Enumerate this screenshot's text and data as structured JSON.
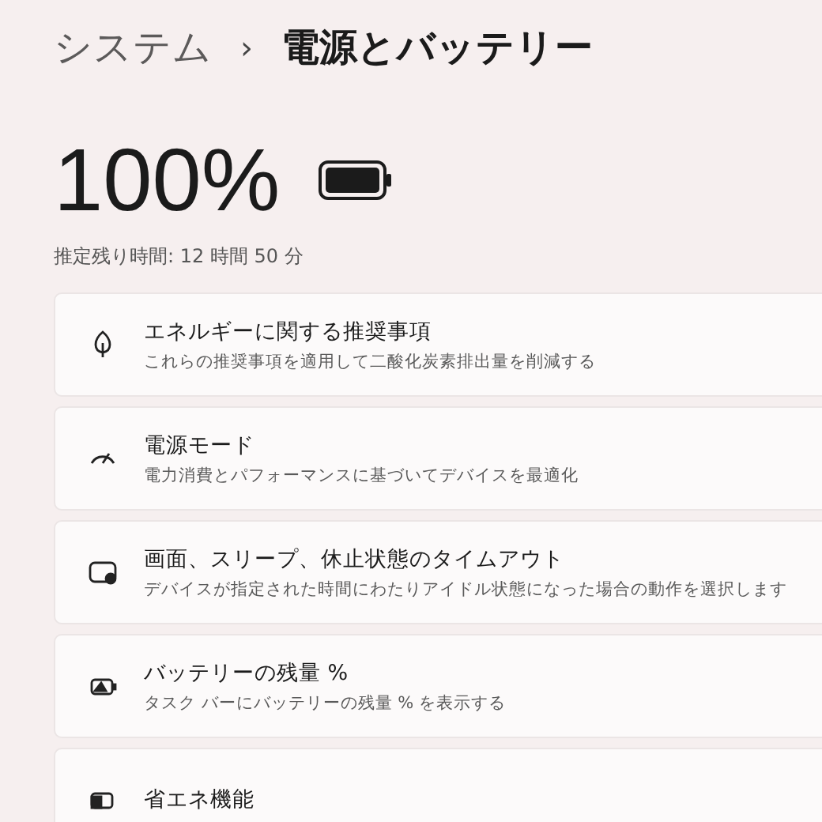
{
  "breadcrumb": {
    "parent": "システム",
    "separator": "›",
    "current": "電源とバッテリー"
  },
  "battery": {
    "percent": "100%",
    "estimate": "推定残り時間: 12 時間 50 分"
  },
  "settings": [
    {
      "kind": "leaf",
      "title": "エネルギーに関する推奨事項",
      "description": "これらの推奨事項を適用して二酸化炭素排出量を削減する"
    },
    {
      "kind": "gauge",
      "title": "電源モード",
      "description": "電力消費とパフォーマンスに基づいてデバイスを最適化"
    },
    {
      "kind": "screen",
      "title": "画面、スリープ、休止状態のタイムアウト",
      "description": "デバイスが指定された時間にわたりアイドル状態になった場合の動作を選択します"
    },
    {
      "kind": "battery",
      "title": "バッテリーの残量 %",
      "description": "タスク バーにバッテリーの残量 % を表示する"
    },
    {
      "kind": "saver",
      "title": "省エネ機能"
    }
  ]
}
